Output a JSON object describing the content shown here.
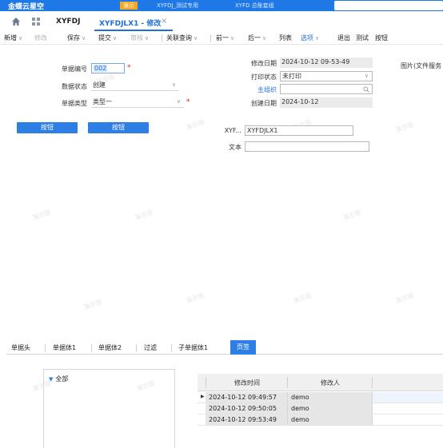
{
  "topbar": {
    "brand": "金蝶云星空",
    "tag": "演示",
    "items": [
      "XYFDJ_测试专用",
      "XYFD 总账套组"
    ]
  },
  "tabs": {
    "first": "XYFDJ",
    "second": "XYFDJLX1 - 修改"
  },
  "toolbar": {
    "new": "新增",
    "modify": "修改",
    "save": "保存",
    "submit": "提交",
    "audit": "审核",
    "related_query": "关联查询",
    "prev": "前一",
    "next": "后一",
    "list": "列表",
    "options": "选项",
    "exit": "退出",
    "test": "测试",
    "button": "按钮"
  },
  "form": {
    "doc_no_label": "单据编号",
    "doc_no_value": "002",
    "status_label": "数据状态",
    "status_value": "创建",
    "type_label": "单据类型",
    "type_value": "类型一",
    "button1": "按钮",
    "button2": "按钮",
    "modified_date_label": "修改日期",
    "modified_date_value": "2024-10-12 09-53-49",
    "print_status_label": "打印状态",
    "print_status_value": "未打印",
    "main_org_label": "主组织",
    "main_org_value": "",
    "created_date_label": "创建日期",
    "created_date_value": "2024-10-12",
    "xyf_label": "XYF...",
    "xyf_value": "XYFDJLX1",
    "text_label": "文本",
    "text_value": "",
    "image_label": "图片(文件服务"
  },
  "watermark": "演示版",
  "bottom_tabs": [
    "单据头",
    "单据体1",
    "单据体2",
    "过滤",
    "子单据体1",
    "页签"
  ],
  "tree": {
    "root": "全部"
  },
  "grid": {
    "headers": [
      "修改时间",
      "修改人"
    ],
    "rows": [
      {
        "time": "2024-10-12 09:49:57",
        "user": "demo"
      },
      {
        "time": "2024-10-12 09:50:05",
        "user": "demo"
      },
      {
        "time": "2024-10-12 09:53:49",
        "user": "demo"
      }
    ]
  }
}
